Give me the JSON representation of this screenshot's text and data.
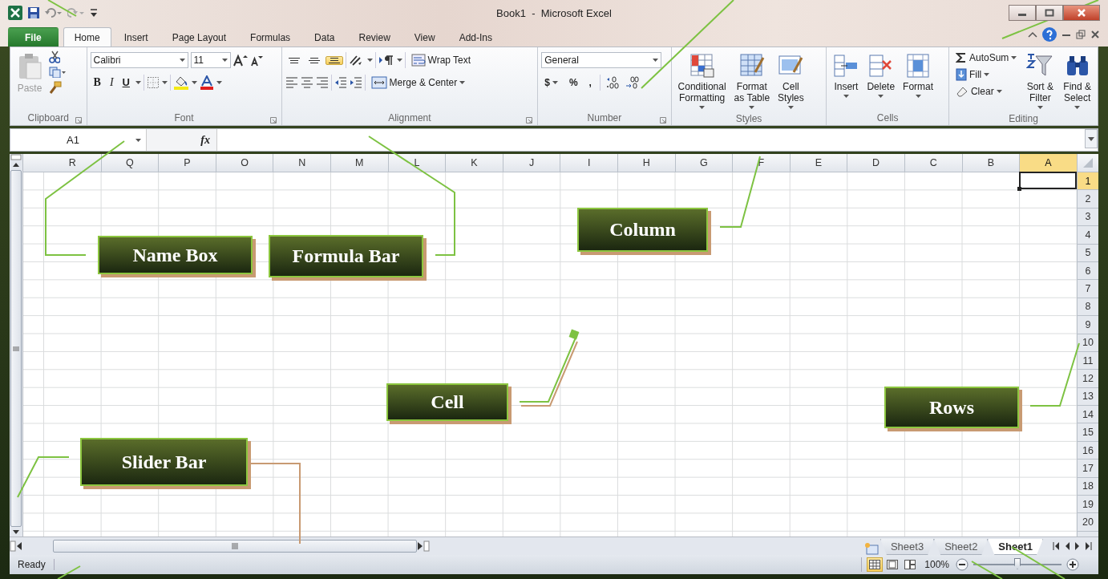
{
  "window": {
    "title": "Book1  -  Microsoft Excel"
  },
  "tabs": [
    {
      "label": "File",
      "kind": "file",
      "selected": false
    },
    {
      "label": "Home",
      "kind": "tab",
      "selected": true
    },
    {
      "label": "Insert",
      "kind": "tab",
      "selected": false
    },
    {
      "label": "Page Layout",
      "kind": "tab",
      "selected": false
    },
    {
      "label": "Formulas",
      "kind": "tab",
      "selected": false
    },
    {
      "label": "Data",
      "kind": "tab",
      "selected": false
    },
    {
      "label": "Review",
      "kind": "tab",
      "selected": false
    },
    {
      "label": "View",
      "kind": "tab",
      "selected": false
    },
    {
      "label": "Add-Ins",
      "kind": "tab",
      "selected": false
    }
  ],
  "ribbon": {
    "clipboard": {
      "label": "Clipboard",
      "paste": "Paste"
    },
    "font": {
      "label": "Font",
      "name": "Calibri",
      "size": "11",
      "bold": "B",
      "italic": "I",
      "underline": "U"
    },
    "alignment": {
      "label": "Alignment",
      "wrap": "Wrap Text",
      "merge": "Merge & Center",
      "vertical_align": [
        {
          "selected": false
        },
        {
          "selected": false
        },
        {
          "selected": true
        }
      ]
    },
    "number": {
      "label": "Number",
      "format": "General",
      "currency": "$",
      "percent": "%",
      "comma": ","
    },
    "styles": {
      "label": "Styles",
      "buttons": [
        "Conditional\nFormatting",
        "Format\nas Table",
        "Cell\nStyles"
      ]
    },
    "cells": {
      "label": "Cells",
      "buttons": [
        "Insert",
        "Delete",
        "Format"
      ]
    },
    "editing": {
      "label": "Editing",
      "autosum": "AutoSum",
      "fill": "Fill",
      "clear": "Clear",
      "sort": "Sort &\nFilter",
      "find": "Find &\nSelect"
    }
  },
  "formula_bar": {
    "name_box": "A1",
    "fx": "fx"
  },
  "grid": {
    "columns": [
      {
        "label": "R",
        "selected": false
      },
      {
        "label": "Q",
        "selected": false
      },
      {
        "label": "P",
        "selected": false
      },
      {
        "label": "O",
        "selected": false
      },
      {
        "label": "N",
        "selected": false
      },
      {
        "label": "M",
        "selected": false
      },
      {
        "label": "L",
        "selected": false
      },
      {
        "label": "K",
        "selected": false
      },
      {
        "label": "J",
        "selected": false
      },
      {
        "label": "I",
        "selected": false
      },
      {
        "label": "H",
        "selected": false
      },
      {
        "label": "G",
        "selected": false
      },
      {
        "label": "F",
        "selected": false
      },
      {
        "label": "E",
        "selected": false
      },
      {
        "label": "D",
        "selected": false
      },
      {
        "label": "C",
        "selected": false
      },
      {
        "label": "B",
        "selected": false
      },
      {
        "label": "A",
        "selected": true
      }
    ],
    "rows": [
      {
        "label": "1",
        "selected": true
      },
      {
        "label": "2",
        "selected": false
      },
      {
        "label": "3",
        "selected": false
      },
      {
        "label": "4",
        "selected": false
      },
      {
        "label": "5",
        "selected": false
      },
      {
        "label": "6",
        "selected": false
      },
      {
        "label": "7",
        "selected": false
      },
      {
        "label": "8",
        "selected": false
      },
      {
        "label": "9",
        "selected": false
      },
      {
        "label": "10",
        "selected": false
      },
      {
        "label": "11",
        "selected": false
      },
      {
        "label": "12",
        "selected": false
      },
      {
        "label": "13",
        "selected": false
      },
      {
        "label": "14",
        "selected": false
      },
      {
        "label": "15",
        "selected": false
      },
      {
        "label": "16",
        "selected": false
      },
      {
        "label": "17",
        "selected": false
      },
      {
        "label": "18",
        "selected": false
      },
      {
        "label": "19",
        "selected": false
      },
      {
        "label": "20",
        "selected": false
      }
    ]
  },
  "sheets": [
    {
      "label": "Sheet3",
      "selected": false
    },
    {
      "label": "Sheet2",
      "selected": false
    },
    {
      "label": "Sheet1",
      "selected": true
    }
  ],
  "status_bar": {
    "text": "Ready",
    "views": [
      {
        "selected": true
      },
      {
        "selected": false
      },
      {
        "selected": false
      }
    ],
    "zoom": "100%",
    "zoom_slider": {
      "level": 0.5
    }
  },
  "callouts": [
    {
      "label": "Name Box"
    },
    {
      "label": "Formula Bar"
    },
    {
      "label": "Column"
    },
    {
      "label": "Cell"
    },
    {
      "label": "Rows"
    },
    {
      "label": "Slider Bar"
    }
  ]
}
